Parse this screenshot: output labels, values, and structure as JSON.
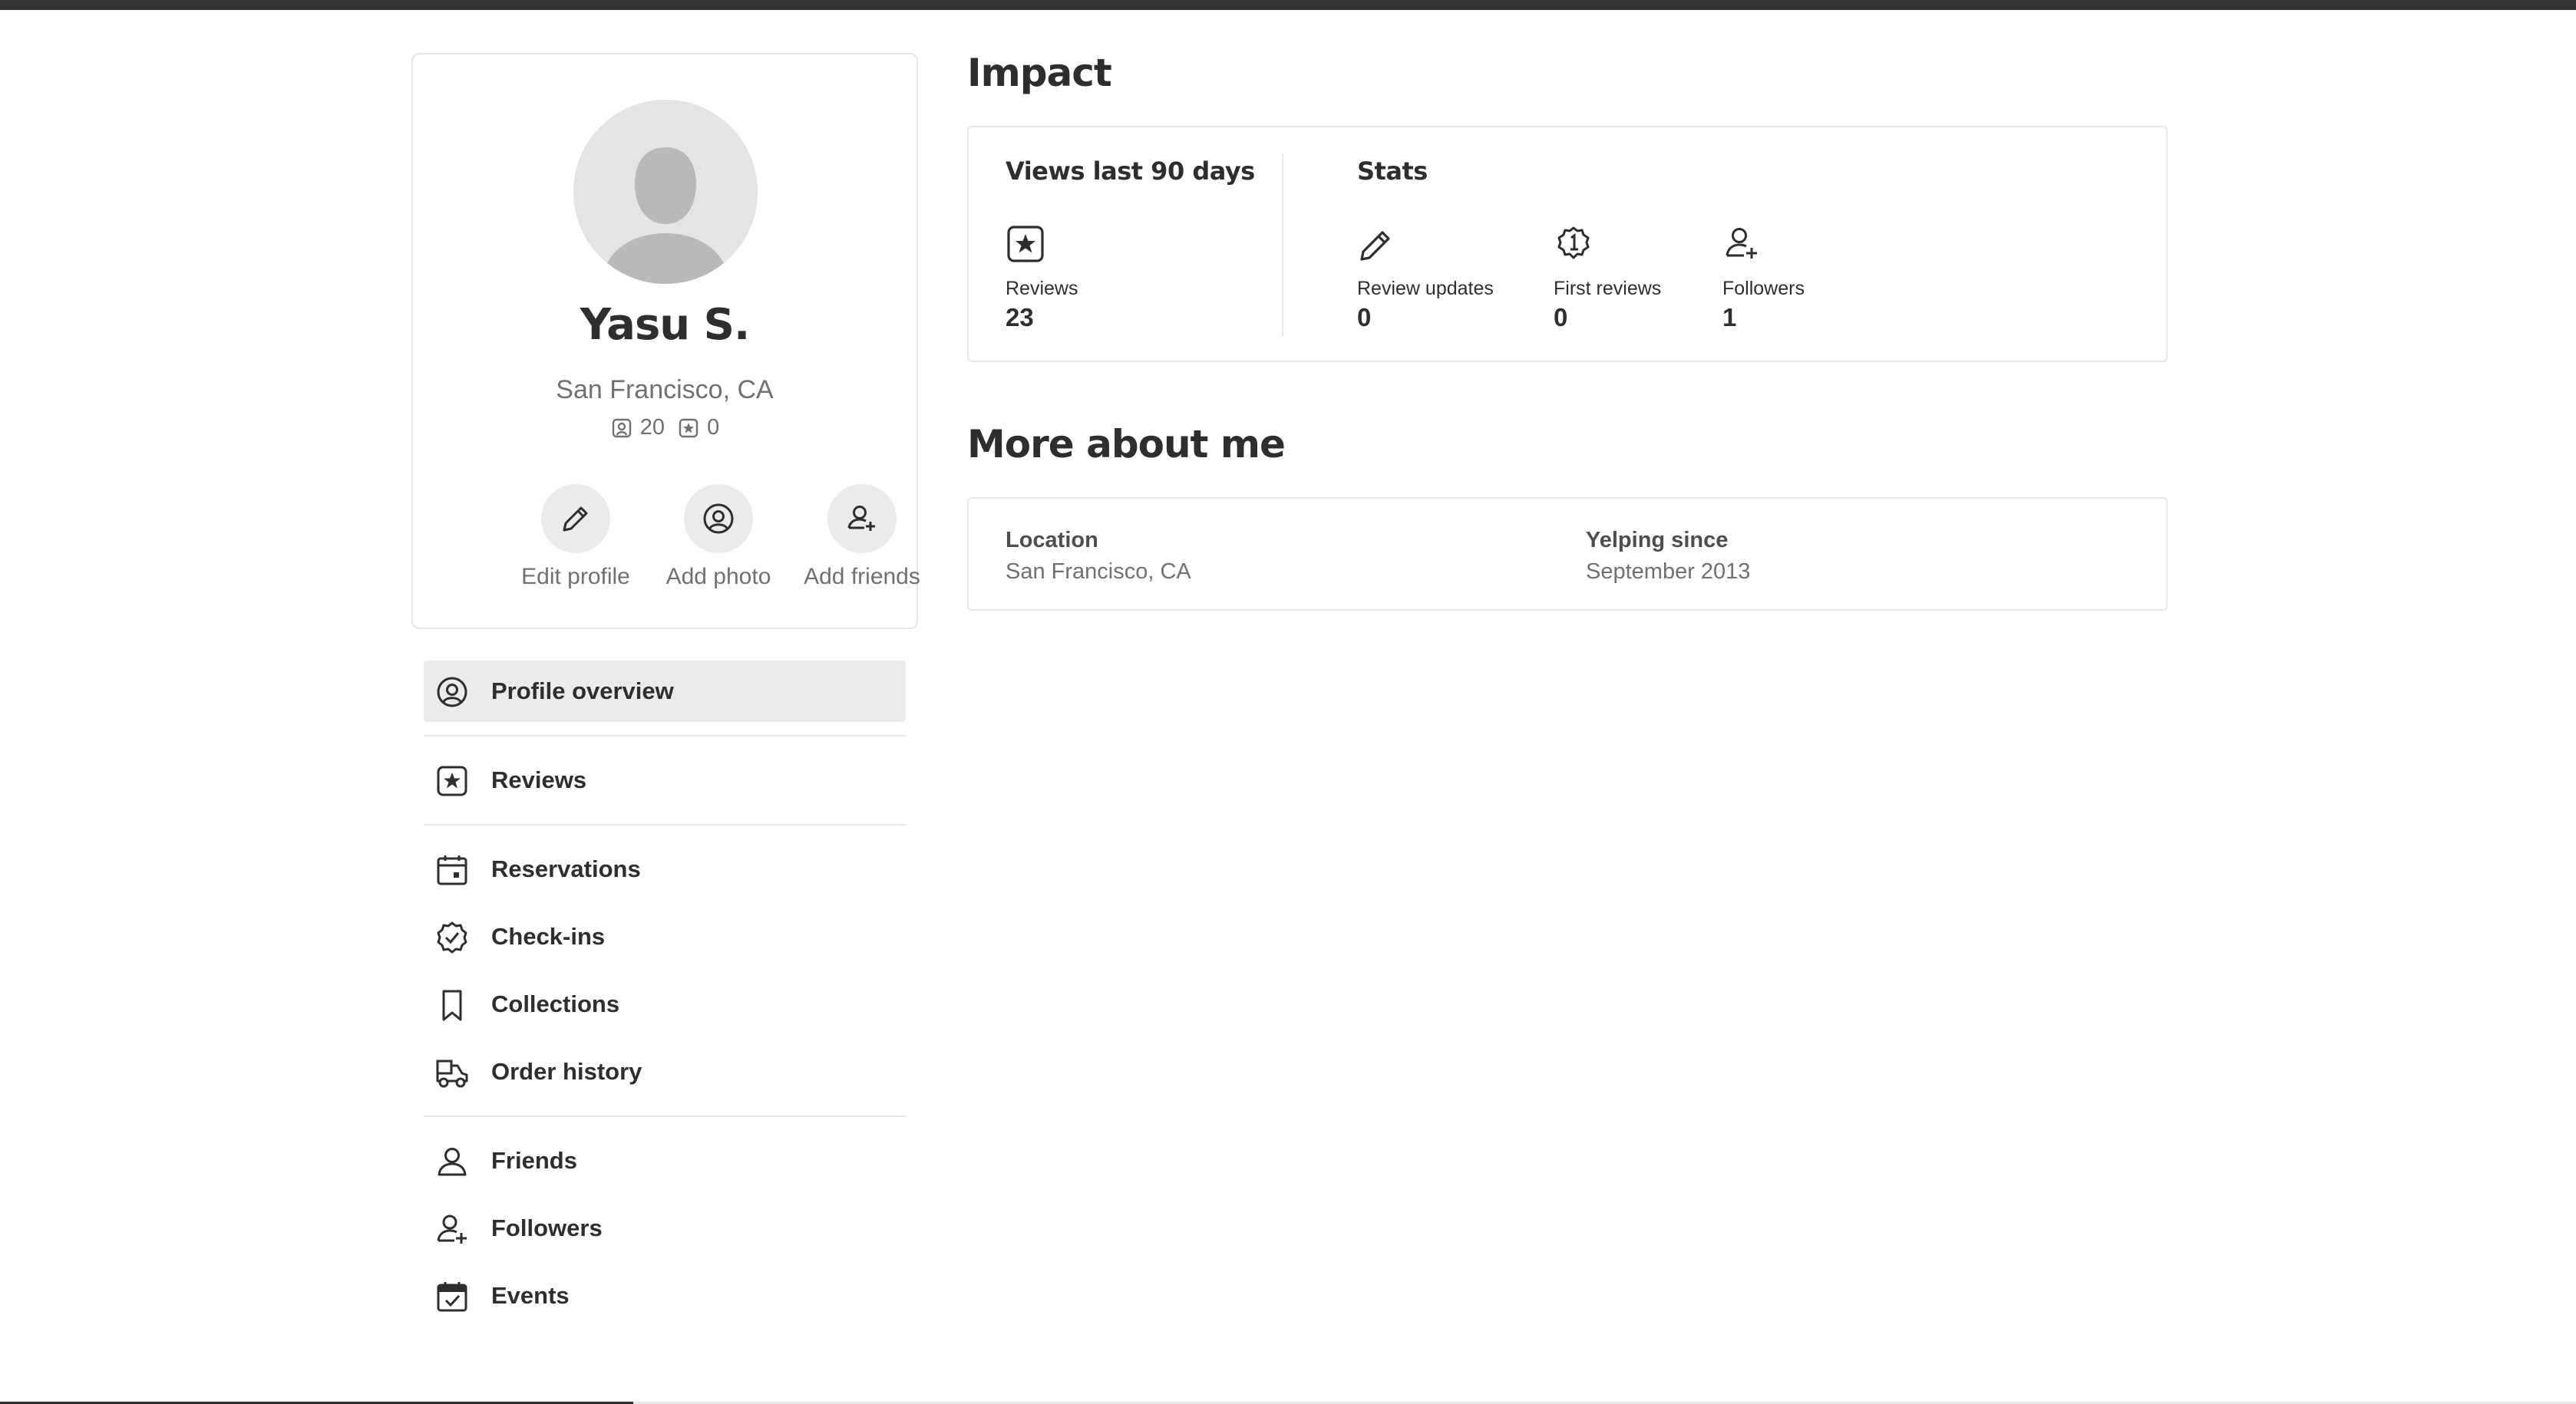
{
  "profile": {
    "name": "Yasu S.",
    "location": "San Francisco, CA",
    "friends_count": "20",
    "reviews_count": "0",
    "actions": [
      {
        "label": "Edit profile",
        "icon": "pencil-icon"
      },
      {
        "label": "Add photo",
        "icon": "camera-icon"
      },
      {
        "label": "Add friends",
        "icon": "add-friend-icon"
      }
    ]
  },
  "nav": {
    "items": [
      {
        "label": "Profile overview",
        "icon": "profile-icon",
        "active": true
      },
      {
        "label": "Reviews",
        "icon": "star-review-icon"
      },
      {
        "label": "Reservations",
        "icon": "calendar-icon"
      },
      {
        "label": "Check-ins",
        "icon": "badge-check-icon"
      },
      {
        "label": "Collections",
        "icon": "bookmark-icon"
      },
      {
        "label": "Order history",
        "icon": "delivery-icon"
      },
      {
        "label": "Friends",
        "icon": "person-icon"
      },
      {
        "label": "Followers",
        "icon": "followers-icon"
      },
      {
        "label": "Events",
        "icon": "calendar-check-icon"
      }
    ]
  },
  "impact": {
    "title": "Impact",
    "views_title": "Views last 90 days",
    "stats_title": "Stats",
    "views": [
      {
        "label": "Reviews",
        "value": "23",
        "icon": "star-review-icon"
      }
    ],
    "stats": [
      {
        "label": "Review updates",
        "value": "0",
        "icon": "pencil-icon"
      },
      {
        "label": "First reviews",
        "value": "0",
        "icon": "first-badge-icon"
      },
      {
        "label": "Followers",
        "value": "1",
        "icon": "followers-icon"
      }
    ]
  },
  "about": {
    "title": "More about me",
    "fields": [
      {
        "key": "Location",
        "value": "San Francisco, CA"
      },
      {
        "key": "Yelping since",
        "value": "September 2013"
      }
    ]
  },
  "colors": {
    "text": "#2d2e2f",
    "muted": "#6e7072",
    "border": "#e6e6e6",
    "active_bg": "#ebebeb",
    "topbar": "#333333"
  }
}
